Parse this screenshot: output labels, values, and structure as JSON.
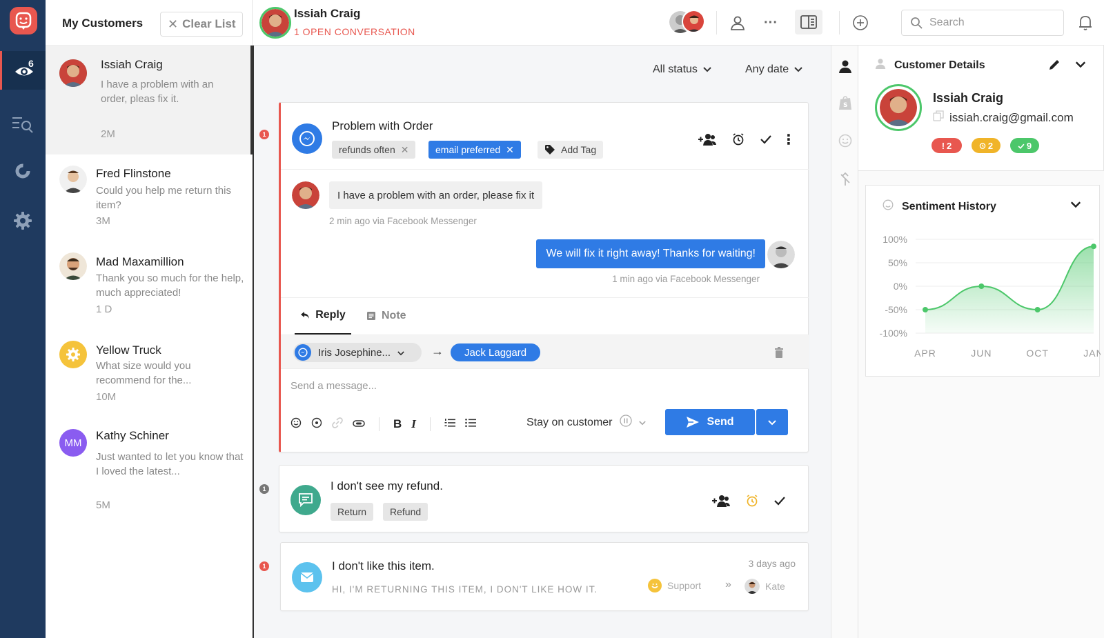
{
  "nav": {
    "badge_count": "6"
  },
  "customer_list": {
    "title": "My Customers",
    "clear_label": "Clear List",
    "items": [
      {
        "name": "Issiah Craig",
        "message": "I have a problem with an order, pleas fix it.",
        "time": "2M",
        "initials": ""
      },
      {
        "name": "Fred Flinstone",
        "message": "Could you help me return this item?",
        "time": "3M",
        "initials": ""
      },
      {
        "name": "Mad Maxamillion",
        "message": "Thank you so much for the help, much appreciated!",
        "time": "1 D",
        "initials": ""
      },
      {
        "name": "Yellow Truck",
        "message": "What size would you recommend for the...",
        "time": "10M",
        "initials": ""
      },
      {
        "name": "Kathy Schiner",
        "message": "Just wanted to let you know that I loved the latest...",
        "time": "5M",
        "initials": "MM"
      }
    ]
  },
  "topbar": {
    "customer_name": "Issiah Craig",
    "conversation_status": "1 OPEN CONVERSATION",
    "search_placeholder": "Search"
  },
  "filters": {
    "status": "All status",
    "date": "Any date"
  },
  "conversation": {
    "unread": "1",
    "title": "Problem with Order",
    "tags": [
      "refunds often",
      "email preferred"
    ],
    "add_tag_label": "Add Tag",
    "incoming_message": "I have a problem with an order, please fix it",
    "incoming_meta": "2 min ago via Facebook Messenger",
    "outgoing_message": "We will fix it right away! Thanks for waiting!",
    "outgoing_meta": "1 min ago via Facebook Messenger",
    "reply_tab": "Reply",
    "note_tab": "Note",
    "from_agent": "Iris Josephine...",
    "to_agent": "Jack Laggard",
    "composer_placeholder": "Send a message...",
    "stay_label": "Stay on customer",
    "send_label": "Send"
  },
  "conversation2": {
    "unread": "1",
    "title": "I don't see my refund.",
    "tags": [
      "Return",
      "Refund"
    ]
  },
  "conversation3": {
    "unread": "1",
    "title": "I don't like this item.",
    "preview": "HI, I'M RETURNING THIS ITEM, I DON'T LIKE HOW IT.",
    "time": "3 days ago",
    "team": "Support",
    "agent": "Kate"
  },
  "customer_details": {
    "title": "Customer Details",
    "name": "Issiah Craig",
    "email": "issiah.craig@gmail.com",
    "badges": [
      {
        "label": "2",
        "color": "#e8574f",
        "icon": "alert-icon"
      },
      {
        "label": "2",
        "color": "#f0b429",
        "icon": "alarm-icon"
      },
      {
        "label": "9",
        "color": "#4cc76a",
        "icon": "check-icon"
      }
    ]
  },
  "sentiment": {
    "title": "Sentiment History"
  },
  "chart_data": {
    "type": "area",
    "title": "Sentiment History",
    "categories": [
      "APR",
      "JUN",
      "OCT",
      "JAN"
    ],
    "y_tick_labels": [
      "100%",
      "50%",
      "0%",
      "-50%",
      "-100%"
    ],
    "ylim": [
      -100,
      100
    ],
    "series": [
      {
        "values": [
          -50,
          0,
          -50,
          85
        ]
      }
    ],
    "color": "#4cc76a"
  }
}
